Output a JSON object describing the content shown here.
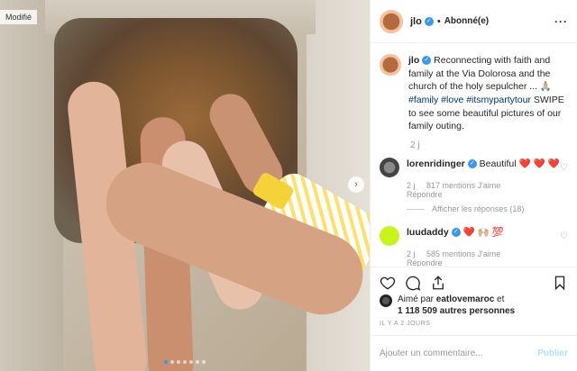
{
  "photo": {
    "badge": "Modifié",
    "next_arrow": "›",
    "carousel_count": 7,
    "carousel_active": 0
  },
  "header": {
    "username": "jlo",
    "separator": "•",
    "follow_status": "Abonné(e)",
    "more": "···"
  },
  "caption": {
    "username": "jlo",
    "text_before": " Reconnecting with faith and family at the Via Dolorosa and the church of the holy sepulcher ... 🙏🏼 ",
    "hashtags": "#family #love #itsmypartytour",
    "text_after": " SWIPE to see some beautiful pictures of our family outing.",
    "time": "2 j"
  },
  "comments": [
    {
      "username": "lorenridinger",
      "text": " Beautiful ",
      "emoji": "❤️ ❤️ ❤️",
      "time": "2 j",
      "likes": "817 mentions J'aime",
      "reply": "Répondre",
      "view_replies": "Afficher les réponses (18)"
    },
    {
      "username": "luudaddy",
      "text": " ",
      "emoji": "❤️ 🙌🏼 💯",
      "time": "2 j",
      "likes": "585 mentions J'aime",
      "reply": "Répondre"
    }
  ],
  "liked_by": {
    "prefix": "Aimé par ",
    "user": "eatlovemaroc",
    "middle": " et",
    "count": "1 118 509 autres personnes"
  },
  "timestamp": "IL Y A 2 JOURS",
  "add_comment": {
    "placeholder": "Ajouter un commentaire...",
    "publish": "Publier"
  },
  "colors": {
    "verified": "#3897f0",
    "link": "#003569",
    "heart": "#e0245e",
    "publish_disabled": "#b2dffc"
  }
}
